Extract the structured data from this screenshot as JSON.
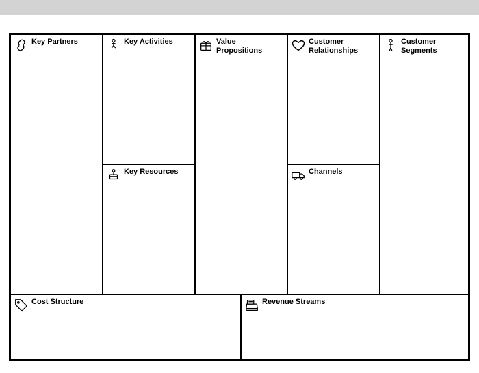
{
  "sections": {
    "key_partners": {
      "title": "Key Partners",
      "icon": "link-icon"
    },
    "key_activities": {
      "title": "Key Activities",
      "icon": "activity-icon"
    },
    "key_resources": {
      "title": "Key Resources",
      "icon": "resources-icon"
    },
    "value_propositions": {
      "title": "Value Propositions",
      "icon": "gift-icon"
    },
    "customer_relationships": {
      "title": "Customer Relationships",
      "icon": "heart-icon"
    },
    "channels": {
      "title": "Channels",
      "icon": "truck-icon"
    },
    "customer_segments": {
      "title": "Customer Segments",
      "icon": "person-icon"
    },
    "cost_structure": {
      "title": "Cost Structure",
      "icon": "tag-icon"
    },
    "revenue_streams": {
      "title": "Revenue Streams",
      "icon": "cash-register-icon"
    }
  }
}
